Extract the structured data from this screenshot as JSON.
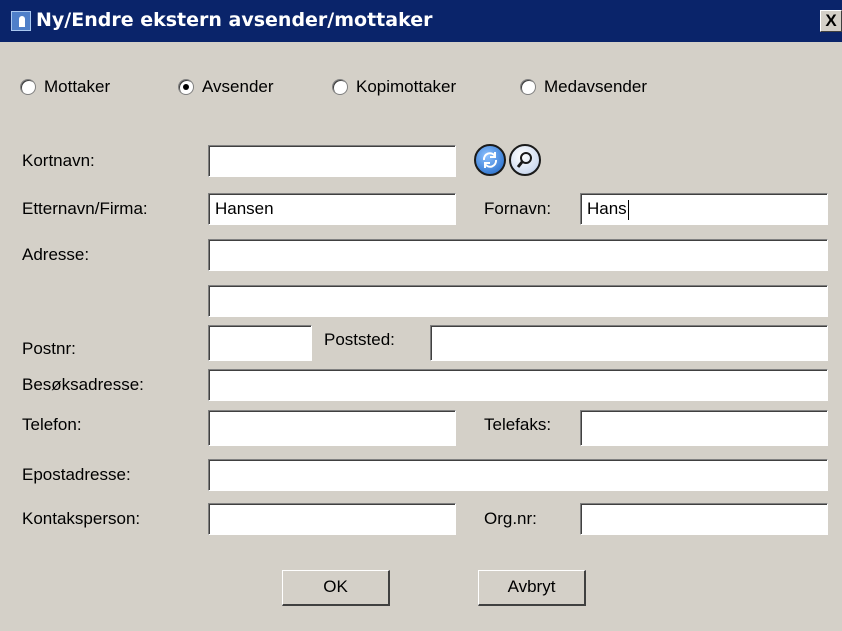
{
  "dialog": {
    "title": "Ny/Endre ekstern avsender/mottaker",
    "close_label": "X"
  },
  "role": {
    "options": [
      {
        "label": "Mottaker",
        "checked": false
      },
      {
        "label": "Avsender",
        "checked": true
      },
      {
        "label": "Kopimottaker",
        "checked": false
      },
      {
        "label": "Medavsender",
        "checked": false
      }
    ]
  },
  "form": {
    "kortnavn": {
      "label": "Kortnavn:",
      "value": ""
    },
    "etternavn": {
      "label": "Etternavn/Firma:",
      "value": "Hansen"
    },
    "fornavn": {
      "label": "Fornavn:",
      "value": "Hans"
    },
    "adresse": {
      "label": "Adresse:",
      "value": "",
      "line2": ""
    },
    "postnr": {
      "label": "Postnr:",
      "value": ""
    },
    "poststed": {
      "label": "Poststed:",
      "value": ""
    },
    "besoksadresse": {
      "label": "Besøksadresse:",
      "value": ""
    },
    "telefon": {
      "label": "Telefon:",
      "value": ""
    },
    "telefaks": {
      "label": "Telefaks:",
      "value": ""
    },
    "epostadresse": {
      "label": "Epostadresse:",
      "value": ""
    },
    "kontaktperson": {
      "label": "Kontaksperson:",
      "value": ""
    },
    "orgnr": {
      "label": "Org.nr:",
      "value": ""
    }
  },
  "icons": {
    "refresh": "refresh-icon",
    "search": "magnifier-icon",
    "refresh_color": "#3b7fd6"
  },
  "buttons": {
    "ok": "OK",
    "cancel": "Avbryt"
  }
}
